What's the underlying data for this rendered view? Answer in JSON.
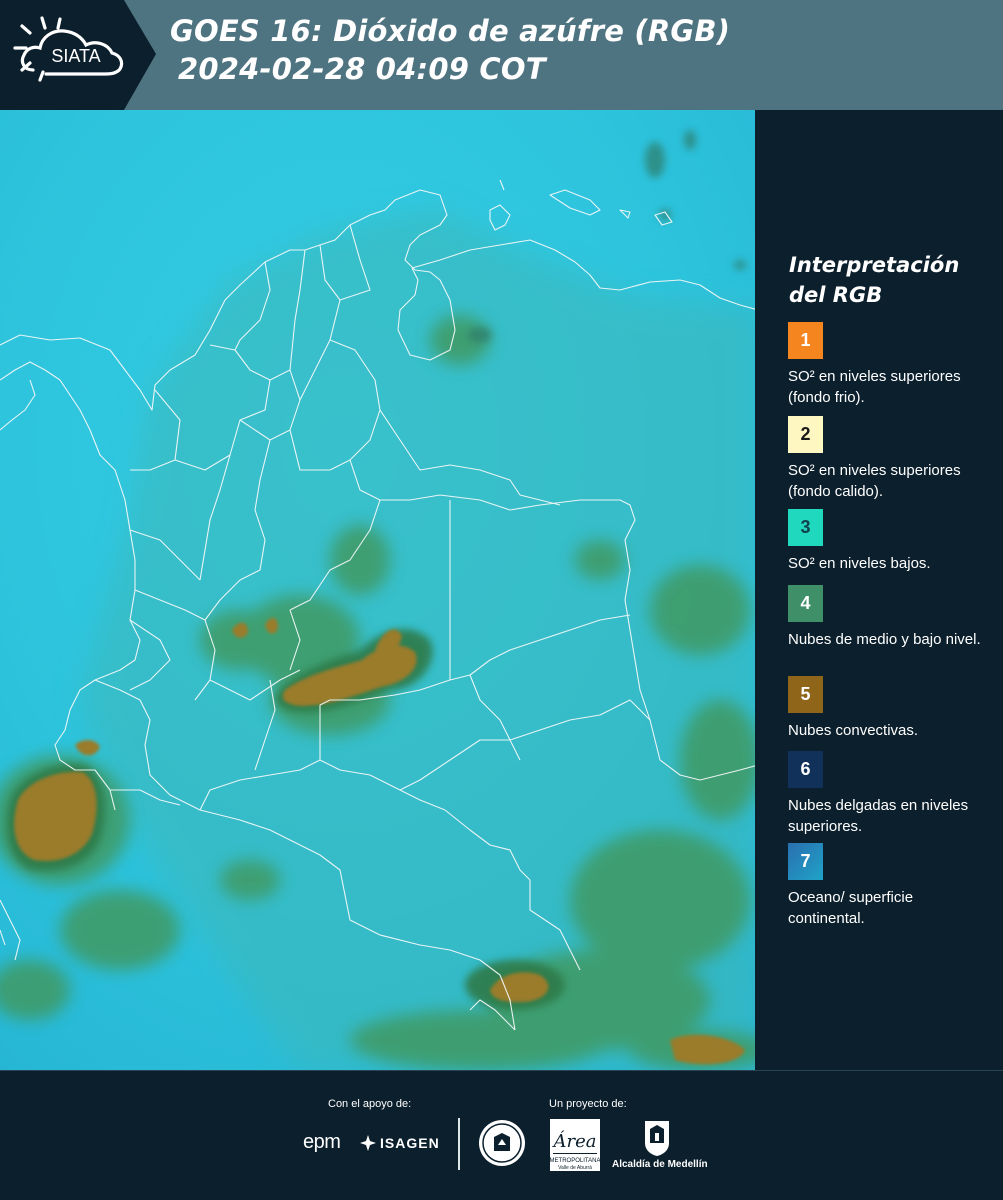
{
  "header": {
    "logo_text": "SIATA",
    "title_line1": "GOES 16: Dióxido de azúfre (RGB)",
    "title_line2": "2024-02-28 04:09 COT"
  },
  "map": {
    "product": "GOES 16 SO2 RGB composite",
    "colors": {
      "ocean_continent": "#2fc8e0",
      "low_mid_clouds": "#3f9a63",
      "convective": "#9a7c2a"
    }
  },
  "legend": {
    "title": "Interpretación del RGB",
    "items": [
      {
        "number": "1",
        "color": "#f5851f",
        "text_color": "#ffffff",
        "label": "SO² en niveles superiores (fondo frio)."
      },
      {
        "number": "2",
        "color": "#fff7c2",
        "text_color": "#1a1a1a",
        "label": "SO² en niveles superiores (fondo calido)."
      },
      {
        "number": "3",
        "color": "#1fd8bd",
        "text_color": "#12414d",
        "label": "SO² en niveles bajos."
      },
      {
        "number": "4",
        "color": "#3f8f68",
        "text_color": "#ffffff",
        "label": "Nubes de medio y bajo nivel."
      },
      {
        "number": "5",
        "color": "#8f6619",
        "text_color": "#ffffff",
        "label": "Nubes convectivas."
      },
      {
        "number": "6",
        "color": "#11315a",
        "text_color": "#ffffff",
        "label": "Nubes delgadas en niveles superiores."
      },
      {
        "number": "7",
        "color": "#1b8fb8",
        "text_color": "#ffffff",
        "label": "Oceano/ superficie continental."
      }
    ]
  },
  "footer": {
    "support_caption": "Con el apoyo de:",
    "project_caption": "Un proyecto de:",
    "sponsors": [
      "epm",
      "ISAGEN"
    ],
    "partners": [
      "Metropolitana Valle de Aburrá",
      "Alcaldía de Medellín"
    ]
  }
}
